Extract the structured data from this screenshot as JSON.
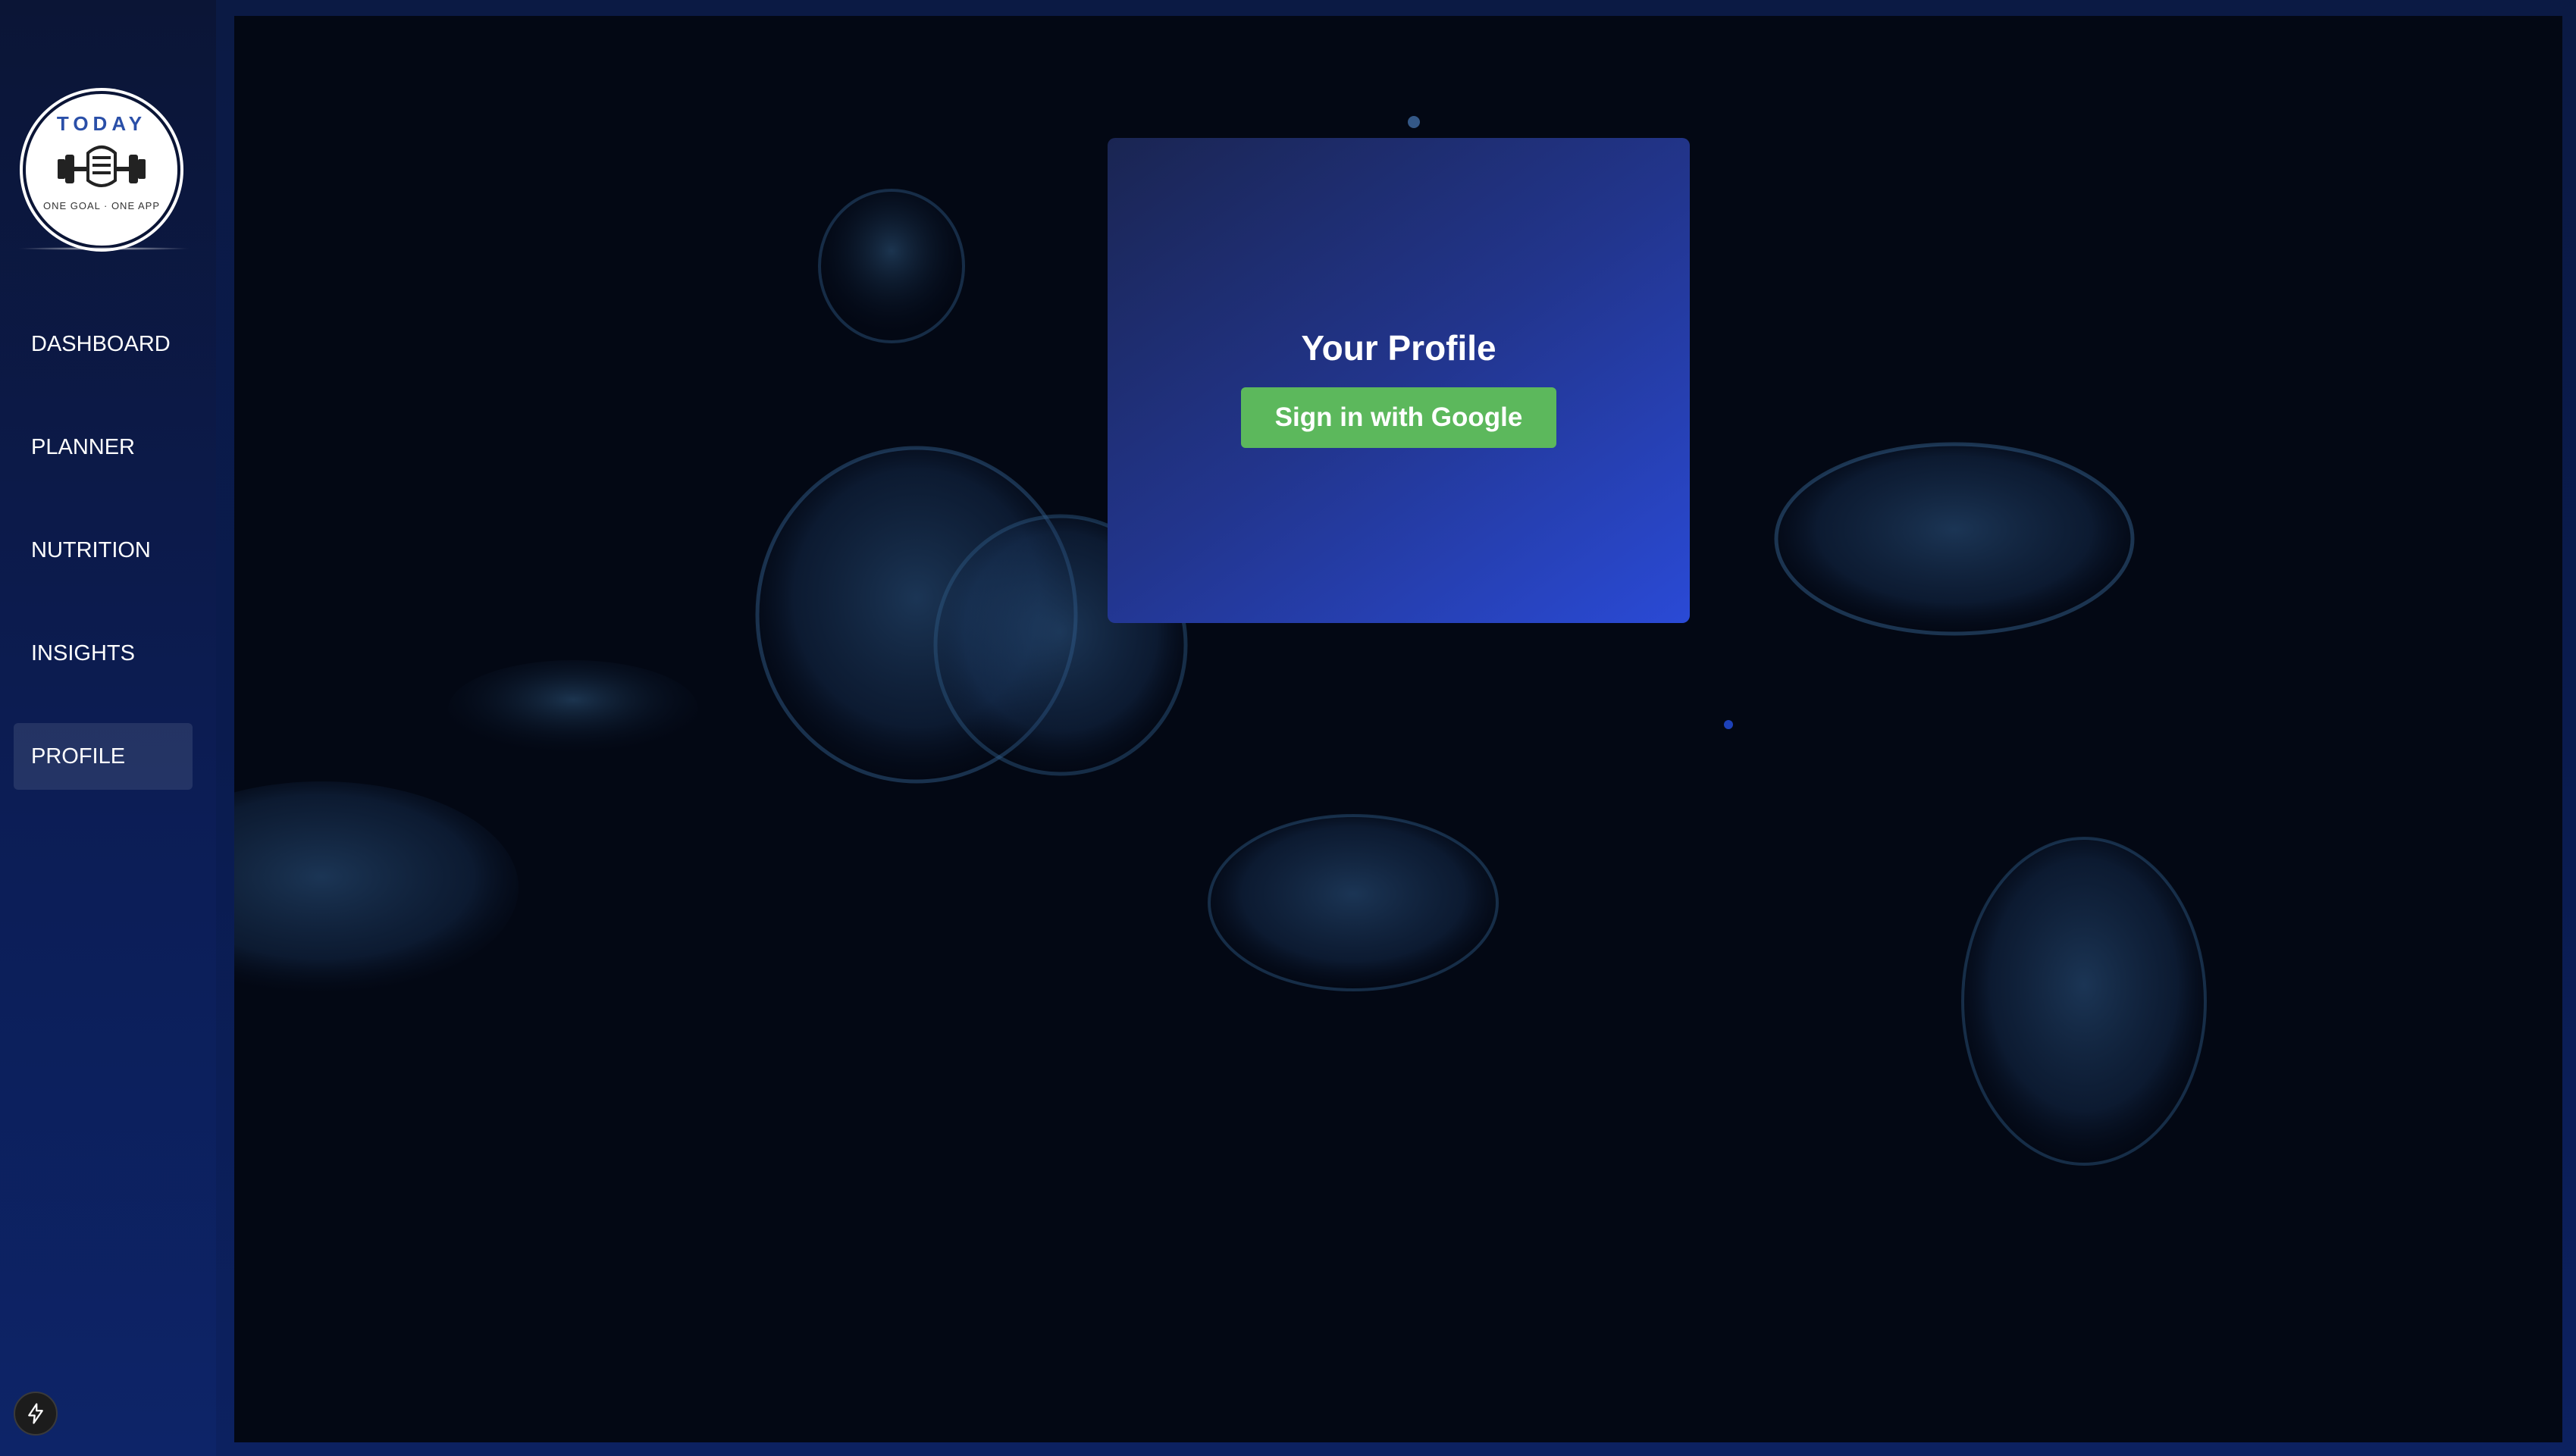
{
  "sidebar": {
    "logo": {
      "brand_text": "TODAY",
      "tagline": "ONE GOAL · ONE APP"
    },
    "items": [
      {
        "label": "DASHBOARD"
      },
      {
        "label": "PLANNER"
      },
      {
        "label": "NUTRITION"
      },
      {
        "label": "INSIGHTS"
      },
      {
        "label": "PROFILE",
        "active": true
      }
    ],
    "bottom_icon": "lightning-bolt-icon"
  },
  "main": {
    "background": "jellyfish-photo",
    "card": {
      "title": "Your Profile",
      "signin_label": "Sign in with Google"
    }
  },
  "colors": {
    "sidebar_bg": "#0c1d55",
    "card_gradient_start": "#1a2552",
    "card_gradient_end": "#2a4ad6",
    "signin_button": "#5cb85c",
    "logo_accent": "#2a4fa8"
  }
}
